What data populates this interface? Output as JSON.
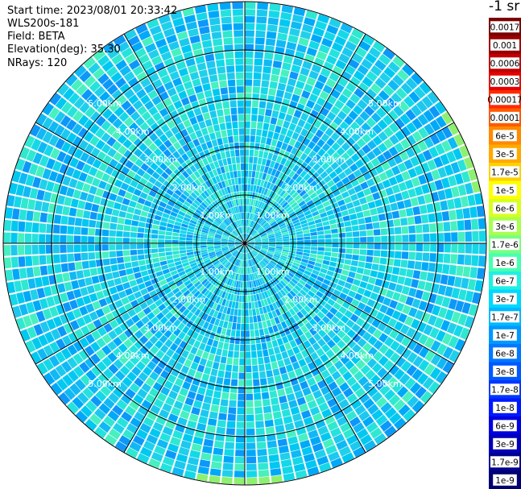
{
  "header": {
    "start_time": "Start time: 2023/08/01 20:33:42",
    "instrument": "WLS200s-181",
    "field": "Field: BETA",
    "elevation": "Elevation(deg): 35.30",
    "nrays": "NRays: 120"
  },
  "colorbar": {
    "unit_label": "-1 sr",
    "labels": [
      "0.0017",
      "0.001",
      "0.0006",
      "0.0003",
      "0.00017",
      "0.0001",
      "6e-5",
      "3e-5",
      "1.7e-5",
      "1e-5",
      "6e-6",
      "3e-6",
      "1.7e-6",
      "1e-6",
      "6e-7",
      "3e-7",
      "1.7e-7",
      "1e-7",
      "6e-8",
      "3e-8",
      "1.7e-8",
      "1e-8",
      "6e-9",
      "3e-9",
      "1.7e-9",
      "1e-9"
    ],
    "colors": [
      "#7a0000",
      "#9a0000",
      "#c00000",
      "#e60000",
      "#ff2a00",
      "#ff5a00",
      "#ff8a00",
      "#ffaa00",
      "#ffd000",
      "#ffff00",
      "#d8ff20",
      "#a8ff50",
      "#78ff80",
      "#48ffb0",
      "#20f0e0",
      "#00d8ff",
      "#00b8ff",
      "#0098ff",
      "#0078ff",
      "#0058ff",
      "#0038ff",
      "#0018ff",
      "#0000e0",
      "#0000b8",
      "#000090",
      "#000070"
    ]
  },
  "chart_data": {
    "type": "heatmap",
    "projection": "polar-ppi",
    "field": "BETA",
    "unit": "sr-1",
    "nrays": 120,
    "azimuth_range": [
      0,
      360
    ],
    "range_rings": [
      "1.00km",
      "2.00km",
      "3.00km",
      "4.00km",
      "5.00km"
    ],
    "spokes": 12,
    "value_range": [
      1e-09,
      0.0017
    ],
    "color_scale": "log",
    "dominant_values": [
      "3e-7",
      "1.7e-7",
      "1e-7",
      "6e-8"
    ],
    "ring_label_text": [
      "1.00km",
      "2.00km",
      "3.00km",
      "4.00km",
      "5.00km"
    ]
  }
}
